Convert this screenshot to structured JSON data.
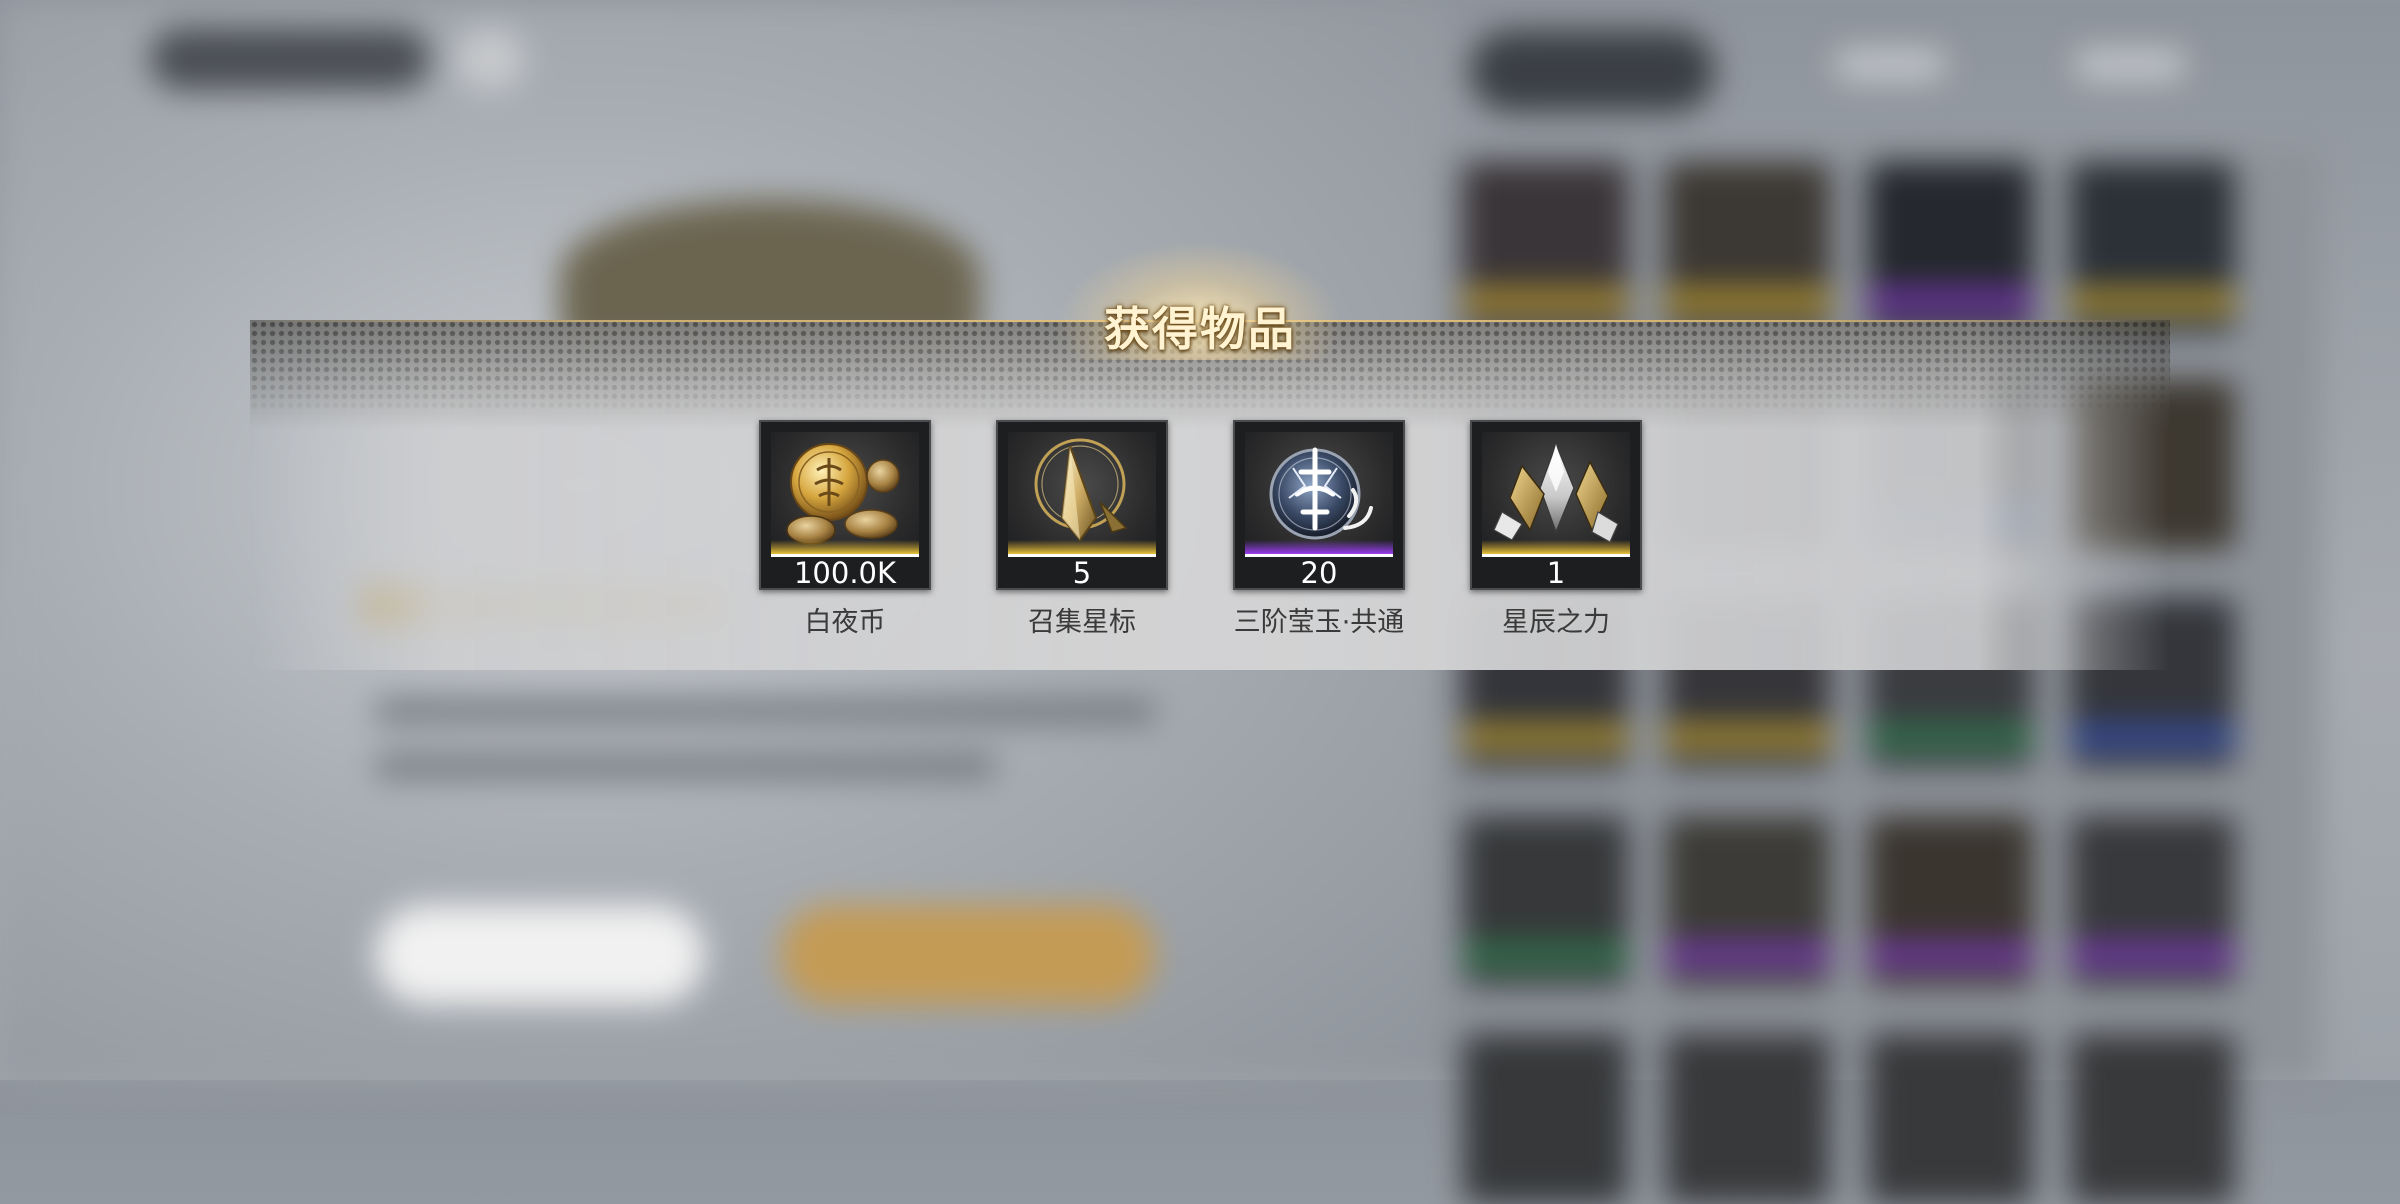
{
  "popup": {
    "title": "获得物品",
    "items": [
      {
        "name": "白夜币",
        "count": "100.0K",
        "rarity": "gold",
        "icon": "coins-icon"
      },
      {
        "name": "召集星标",
        "count": "5",
        "rarity": "gold",
        "icon": "star-marker-icon"
      },
      {
        "name": "三阶莹玉·共通",
        "count": "20",
        "rarity": "purple",
        "icon": "jade-rune-icon"
      },
      {
        "name": "星辰之力",
        "count": "1",
        "rarity": "gold",
        "icon": "crystal-shard-icon"
      }
    ]
  },
  "colors": {
    "rarity_gold": "#e7c43c",
    "rarity_purple": "#9a3df0",
    "title_text": "#fff3d2",
    "banner_line": "#e3c281"
  }
}
